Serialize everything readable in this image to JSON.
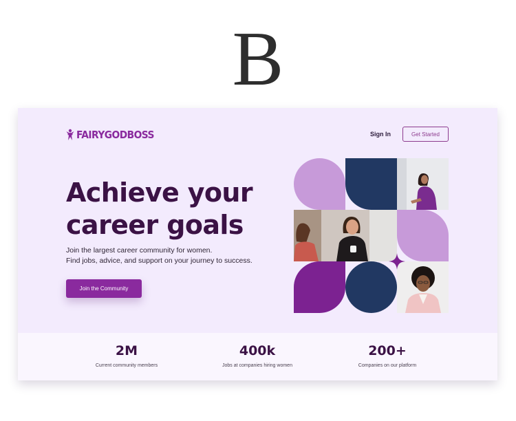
{
  "decor": {
    "letter": "B"
  },
  "header": {
    "brand": "FAIRYGODBOSS",
    "sign_in": "Sign In",
    "get_started": "Get Started"
  },
  "hero": {
    "title": "Achieve your career goals",
    "subtitle_line1": "Join the largest career community for women.",
    "subtitle_line2": "Find jobs, advice, and support on your journey to success.",
    "cta": "Join the Community"
  },
  "stats": [
    {
      "value": "2M",
      "label": "Current community members"
    },
    {
      "value": "400k",
      "label": "Jobs at companies hiring women"
    },
    {
      "value": "200+",
      "label": "Companies on our platform"
    }
  ],
  "colors": {
    "brand_purple": "#8a2a9e",
    "headline": "#3b1245",
    "lavender": "#c79ad9",
    "navy": "#213862",
    "deep_purple": "#7c2291",
    "background": "#f3ebfd"
  }
}
